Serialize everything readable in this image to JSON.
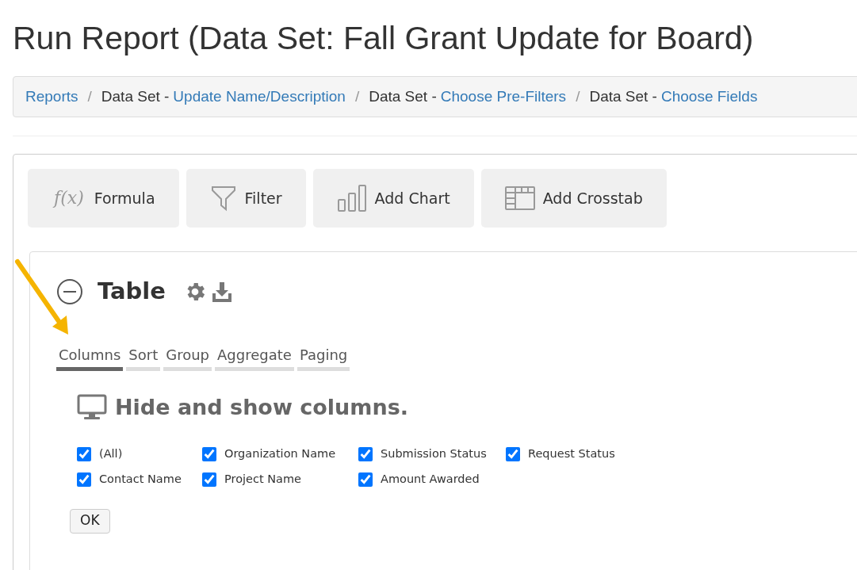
{
  "page_title": "Run Report (Data Set: Fall Grant Update for Board)",
  "breadcrumbs": [
    {
      "link": "Reports"
    },
    {
      "separator": "/",
      "prefix": "Data Set -",
      "link": "Update Name/Description"
    },
    {
      "separator": "/",
      "prefix": "Data Set -",
      "link": "Choose Pre-Filters"
    },
    {
      "separator": "/",
      "prefix": "Data Set -",
      "link": "Choose Fields"
    }
  ],
  "toolbar": [
    {
      "kind": "formula",
      "icon_text": "f(x)",
      "label": "Formula"
    },
    {
      "kind": "filter",
      "label": "Filter"
    },
    {
      "kind": "chart",
      "label": "Add Chart"
    },
    {
      "kind": "crosstab",
      "label": "Add Crosstab"
    }
  ],
  "section": {
    "title": "Table",
    "expanded": true
  },
  "tabs": [
    {
      "label": "Columns",
      "selected": true
    },
    {
      "label": "Sort",
      "selected": false
    },
    {
      "label": "Group",
      "selected": false
    },
    {
      "label": "Aggregate",
      "selected": false
    },
    {
      "label": "Paging",
      "selected": false
    }
  ],
  "columns_heading": "Hide and show columns.",
  "columns": [
    {
      "label": "(All)",
      "checked": true
    },
    {
      "label": "Organization Name",
      "checked": true
    },
    {
      "label": "Submission Status",
      "checked": true
    },
    {
      "label": "Request Status",
      "checked": true
    },
    {
      "label": "Contact Name",
      "checked": true
    },
    {
      "label": "Project Name",
      "checked": true
    },
    {
      "label": "Amount Awarded",
      "checked": true
    }
  ],
  "ok_button": "OK"
}
